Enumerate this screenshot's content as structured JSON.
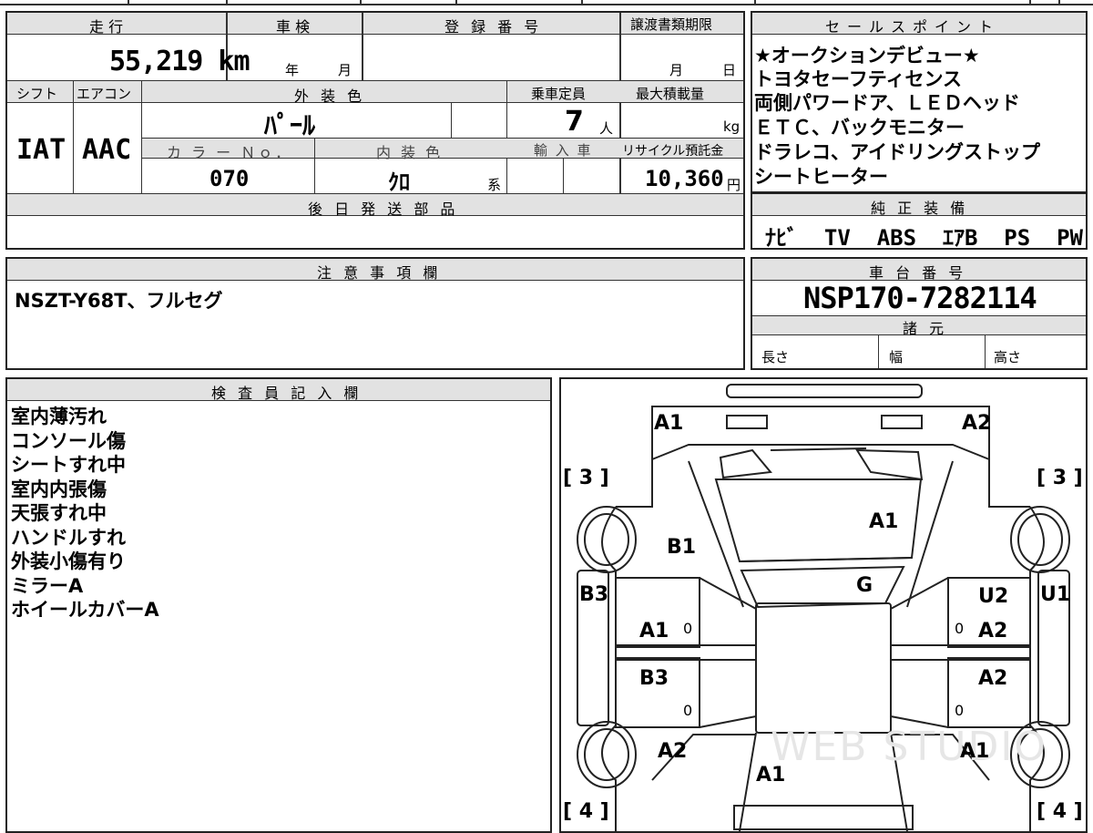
{
  "sheet": {
    "mileage_label": "走 行",
    "mileage_value": "55,219 km",
    "inspection_label": "車 検",
    "inspection_year": "年",
    "inspection_month": "月",
    "reg_label": "登 録 番 号",
    "deadline_label": "譲渡書類期限",
    "deadline_month": "月",
    "deadline_day": "日",
    "shift_label": "シフト",
    "shift_value": "IAT",
    "ac_label": "エアコン",
    "ac_value": "AAC",
    "exterior_label": "外 装 色",
    "exterior_value": "ﾊﾟｰﾙ",
    "capacity_label": "乗車定員",
    "capacity_value": "7",
    "capacity_unit": "人",
    "maxload_label": "最大積載量",
    "maxload_unit": "kg",
    "color_no_label": "カ ラ ー Ｎｏ．",
    "color_no_value": "070",
    "interior_label": "内 装 色",
    "interior_value": "ｸﾛ",
    "interior_suffix": "系",
    "import_label": "輸 入 車",
    "recycle_label": "リサイクル預託金",
    "recycle_value": "10,360",
    "recycle_unit": "円",
    "later_parts_label": "後 日 発 送 部 品"
  },
  "sales": {
    "label": "セールスポイント",
    "lines": [
      "★オークションデビュー★",
      "トヨタセーフティセンス",
      "両側パワードア、ＬＥＤヘッド",
      "ＥＴＣ、バックモニター",
      "ドラレコ、アイドリングストップ",
      "シートヒーター"
    ]
  },
  "equipment": {
    "label": "純 正 装 備",
    "value": "ﾅﾋﾞ  TV  ABS  ｴｱB  PS  PW"
  },
  "notes": {
    "label": "注 意 事 項 欄",
    "value": "NSZT-Y68T、フルセグ"
  },
  "chassis": {
    "label": "車 台 番 号",
    "value": "NSP170-7282114",
    "spec_label": "諸 元",
    "length_label": "長さ",
    "width_label": "幅",
    "height_label": "高さ"
  },
  "inspector": {
    "label": "検 査 員 記 入 欄",
    "lines": [
      "室内薄汚れ",
      "コンソール傷",
      "シートすれ中",
      "室内内張傷",
      "天張すれ中",
      "ハンドルすれ",
      "外装小傷有り",
      "ミラーA",
      "ホイールカバーA"
    ]
  },
  "diagram": {
    "labels": {
      "front_left": "A1",
      "front_right": "A2",
      "tire_fl": "[ 3 ]",
      "tire_fr": "[ 3 ]",
      "hood": "A1",
      "fender_left": "B1",
      "windshield": "G",
      "mirror_left": "B3",
      "door_fl": "A1",
      "door_rl": "B3",
      "mirror_right_u": "U2",
      "mirror_right": "U1",
      "door_fr": "A2",
      "door_rr": "A2",
      "quarter_left": "A2",
      "quarter_right": "A1",
      "rear": "A1",
      "tire_rl": "[ 4 ]",
      "tire_rr": "[ 4 ]",
      "zero_1": "0",
      "zero_2": "0",
      "zero_3": "0",
      "zero_4": "0"
    },
    "watermark": "WEB STUDIO"
  }
}
